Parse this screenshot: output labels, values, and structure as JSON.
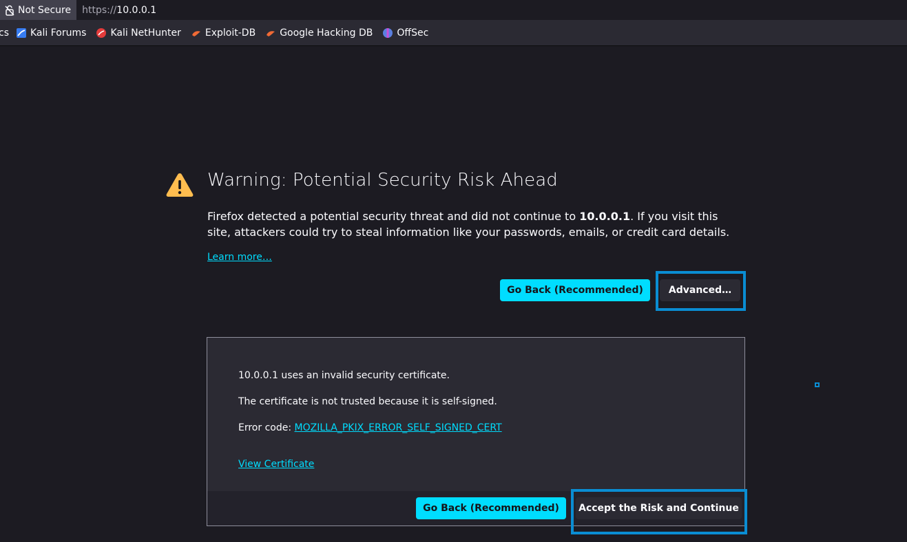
{
  "urlbar": {
    "identity_label": "Not Secure",
    "url_scheme": "https://",
    "url_host": "10.0.0.1"
  },
  "bookmarks": [
    {
      "label": "cs",
      "icon": "kali-docs-icon"
    },
    {
      "label": "Kali Forums",
      "icon": "kali-forums-icon"
    },
    {
      "label": "Kali NetHunter",
      "icon": "kali-nethunter-icon"
    },
    {
      "label": "Exploit-DB",
      "icon": "exploit-db-icon"
    },
    {
      "label": "Google Hacking DB",
      "icon": "ghdb-icon"
    },
    {
      "label": "OffSec",
      "icon": "offsec-icon"
    }
  ],
  "error_page": {
    "title": "Warning: Potential Security Risk Ahead",
    "desc_part1": "Firefox detected a potential security threat and did not continue to ",
    "desc_host": "10.0.0.1",
    "desc_part2": ". If you visit this site, attackers could try to steal information like your passwords, emails, or credit card details.",
    "learn_more": "Learn more…",
    "go_back_label": "Go Back (Recommended)",
    "advanced_label": "Advanced…"
  },
  "advanced_panel": {
    "line1": "10.0.0.1 uses an invalid security certificate.",
    "line2": "The certificate is not trusted because it is self-signed.",
    "error_code_label": "Error code: ",
    "error_code": "MOZILLA_PKIX_ERROR_SELF_SIGNED_CERT",
    "view_certificate": "View Certificate",
    "go_back_label": "Go Back (Recommended)",
    "accept_label": "Accept the Risk and Continue"
  },
  "colors": {
    "accent": "#00ddff",
    "highlight": "#0a8dd3",
    "warning": "#ffbd4f",
    "background": "#1c1b22"
  }
}
